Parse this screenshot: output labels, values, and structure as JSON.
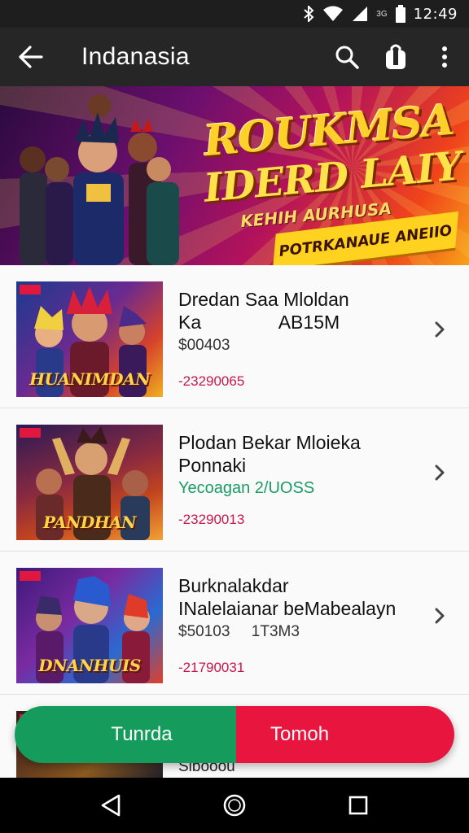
{
  "status_bar": {
    "time": "12:49",
    "signal_label": "3G",
    "icons": [
      "bluetooth-icon",
      "wifi-icon",
      "signal-icon",
      "battery-icon"
    ]
  },
  "app_bar": {
    "title": "Indanasia",
    "icons": [
      "back-arrow-icon",
      "search-icon",
      "bag-icon",
      "more-vert-icon"
    ]
  },
  "banner": {
    "title_line1": "ROUKMSA",
    "title_line2": "IDERD LAIY",
    "subtitle": "KEHIH AURHUSA",
    "ribbon": "POTRKANAUE ANEIIO",
    "colors": {
      "from": "#2a0a3d",
      "mid": "#b3125b",
      "to": "#f7a219"
    }
  },
  "items": [
    {
      "title": "Dredan Saa Mloldan",
      "line2": "Ka               AB15M",
      "price": "$00403",
      "code": "-23290065",
      "thumb_caption": "HUANIMDAN",
      "thumb_colors": [
        "#1a3a8f",
        "#d6422a",
        "#f0b020"
      ]
    },
    {
      "title": "Plodan Bekar Mloieka",
      "line2": "Ponnaki",
      "green": "Yecoagan 2/UOSS",
      "code": "-23290013",
      "thumb_caption": "PANDHAN",
      "thumb_colors": [
        "#2a1a55",
        "#c2441e",
        "#f2a233"
      ]
    },
    {
      "title": "Burknalakdar",
      "line2": "INalelaianar beMabealayn",
      "price": "$50103     1T3M3",
      "code": "-21790031",
      "thumb_caption": "DNANHUIS",
      "thumb_colors": [
        "#3b1a7a",
        "#2a6ad0",
        "#e0402a"
      ]
    }
  ],
  "partial_item": {
    "text": "Sibooou"
  },
  "actions": {
    "left_label": "Tunrda",
    "right_label": "Tomoh",
    "left_color": "#159c5d",
    "right_color": "#e8153f"
  },
  "nav": {
    "icons": [
      "nav-back-icon",
      "nav-home-icon",
      "nav-recents-icon"
    ]
  }
}
